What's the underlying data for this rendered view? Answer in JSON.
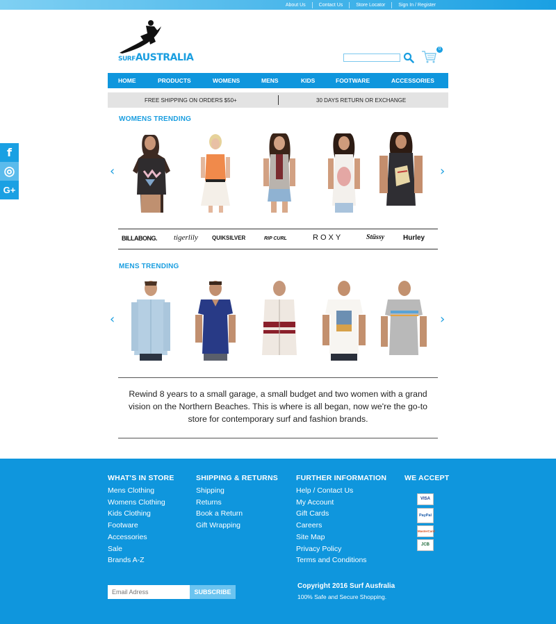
{
  "top_links": [
    "About Us",
    "Contact Us",
    "Store Locator",
    "Sign In / Register"
  ],
  "logo": {
    "small": "SURF",
    "large": "AUSTRALIA"
  },
  "cart": {
    "count": "0"
  },
  "nav": [
    "HOME",
    "PRODUCTS",
    "WOMENS",
    "MENS",
    "KIDS",
    "FOOTWARE",
    "ACCESSORIES"
  ],
  "promo": {
    "left": "FREE SHIPPING ON ORDERS $50+",
    "right": "30 DAYS RETURN OR EXCHANGE"
  },
  "womens": {
    "title": "WOMENS TRENDING"
  },
  "mens": {
    "title": "MENS TRENDING"
  },
  "arrows": {
    "prev": "‹",
    "next": "›"
  },
  "social": {
    "facebook": "f",
    "instagram": "◎",
    "google": "G+"
  },
  "brands": [
    "BILLABONG.",
    "tigerlily",
    "QUIKSILVER",
    "RIP CURL",
    "ROXY",
    "Stüssy",
    "Hurley"
  ],
  "story": "Rewind 8 years to a small garage, a small budget and two women with a grand vision on the Northern Beaches. This is where is all began, now we're the go-to store for contemporary surf and fashion brands.",
  "footer": {
    "col1": {
      "title": "WHAT'S IN STORE",
      "links": [
        "Mens Clothing",
        "Womens Clothing",
        "Kids Clothing",
        "Footware",
        "Accessories",
        "Sale",
        "Brands A-Z"
      ]
    },
    "col2": {
      "title": "SHIPPING & RETURNS",
      "links": [
        "Shipping",
        "Returns",
        "Book a Return",
        "Gift Wrapping"
      ]
    },
    "col3": {
      "title": "FURTHER INFORMATION",
      "links": [
        "Help / Contact Us",
        "My Account",
        "Gift Cards",
        "Careers",
        "Site Map",
        "Privacy Policy",
        "Terms and Conditions"
      ]
    },
    "col4": {
      "title": "WE ACCEPT",
      "cards": [
        "VISA",
        "PayPal",
        "MasterCard",
        "JCB"
      ]
    },
    "email_placeholder": "Email Adress",
    "subscribe": "SUBSCRIBE",
    "copyright": "Copyright 2016 Surf Ausfralia",
    "secure": "100% Safe and Secure Shopping."
  },
  "colors": {
    "brand_blue": "#0f96dd",
    "light_blue": "#6cc4f0"
  }
}
